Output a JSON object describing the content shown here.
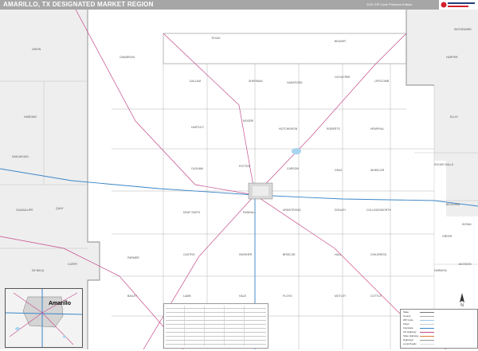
{
  "title": "AMARILLO, TX DESIGNATED MARKET REGION",
  "edition": "2021 ZIP Code Premium Edition",
  "logo_text": "Market Maps",
  "counties": [
    "DALLAM",
    "SHERMAN",
    "HANSFORD",
    "OCHILTREE",
    "LIPSCOMB",
    "HARTLEY",
    "MOORE",
    "HUTCHINSON",
    "ROBERTS",
    "HEMPHILL",
    "OLDHAM",
    "POTTER",
    "CARSON",
    "GRAY",
    "WHEELER",
    "DEAF SMITH",
    "RANDALL",
    "ARMSTRONG",
    "DONLEY",
    "COLLINGSWORTH",
    "PARMER",
    "CASTRO",
    "SWISHER",
    "BRISCOE",
    "HALL",
    "CHILDRESS",
    "BAILEY",
    "LAMB",
    "HALE",
    "FLOYD",
    "MOTLEY",
    "COTTLE",
    "UNION",
    "CIMARRON",
    "TEXAS",
    "BEAVER",
    "HARPER",
    "ELLIS",
    "HARDING",
    "QUAY",
    "CURRY",
    "DE BACA",
    "ROOSEVELT",
    "SAN MIGUEL",
    "GUADALUPE",
    "BECKHAM",
    "GREER",
    "HARMON",
    "JACKSON",
    "ROGER MILLS",
    "WOODWARD",
    "KIOWA"
  ],
  "cities": [
    "Amarillo"
  ],
  "inset": {
    "city": "Amarillo"
  },
  "legend": {
    "items": [
      "State",
      "County",
      "ZIP Code",
      "Cities",
      "Interstate",
      "US Highway",
      "State Highway",
      "Highways",
      "Local Roads"
    ]
  },
  "compass": "N"
}
